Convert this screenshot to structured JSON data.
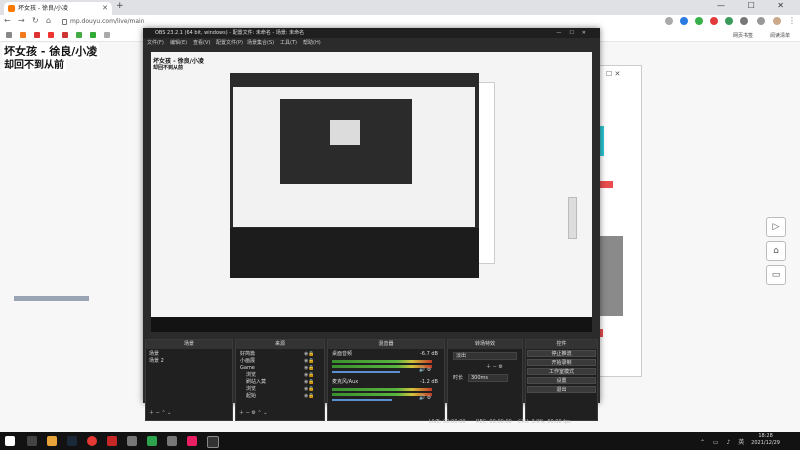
{
  "browser": {
    "tab_title": "坏女孩 - 徐良/小凌",
    "new_tab": "+",
    "window_controls": "— ☐ ✕",
    "url": "mp.douyu.com/live/main",
    "bookmarks": [
      "网页书签",
      "阅读清单"
    ]
  },
  "page": {
    "song_title": "坏女孩 - 徐良/小凌",
    "song_line": "却回不到从前"
  },
  "obs": {
    "window_title": "OBS 23.2.1 (64 bit, windows) - 配置文件: 未命名 - 场景: 未命名",
    "menu": [
      "文件(F)",
      "编辑(E)",
      "查看(V)",
      "配置文件(P)",
      "场景集合(S)",
      "工具(T)",
      "帮助(H)"
    ],
    "preview_overlay_title": "坏女孩 - 徐良/小凌",
    "preview_overlay_line": "却回不到从前",
    "panels": {
      "scenes": {
        "title": "场景",
        "items": [
          "场景",
          "场景 2"
        ]
      },
      "sources": {
        "title": "来源",
        "items": [
          "好简篇",
          "小画展",
          "Game",
          "浏览",
          "刷站入莫",
          "浏览",
          "起始"
        ]
      },
      "mixer": {
        "title": "混音器",
        "channels": [
          {
            "name": "桌面音频",
            "value": "-6.7 dB"
          },
          {
            "name": "麦克风/Aux",
            "value": "-1.2 dB"
          }
        ]
      },
      "transitions": {
        "title": "转场特效",
        "type": "淡出",
        "duration_label": "时长",
        "duration": "300ms"
      },
      "controls": {
        "title": "控件",
        "buttons": [
          "停止推流",
          "开始录制",
          "工作室模式",
          "设置",
          "退出"
        ]
      }
    },
    "status": {
      "live": "LIVE: 00:00:00",
      "rec": "REC: 00:00:00",
      "cpu": "CPU: 3.9%, 60.00 fps"
    }
  },
  "taskbar": {
    "time": "18:28",
    "date": "2021/12/29"
  },
  "colors": {
    "obs_bg": "#2b2b2b",
    "meter_green": "#59b43f",
    "meter_red": "#c23a2a",
    "brand": "#ff7a00"
  }
}
